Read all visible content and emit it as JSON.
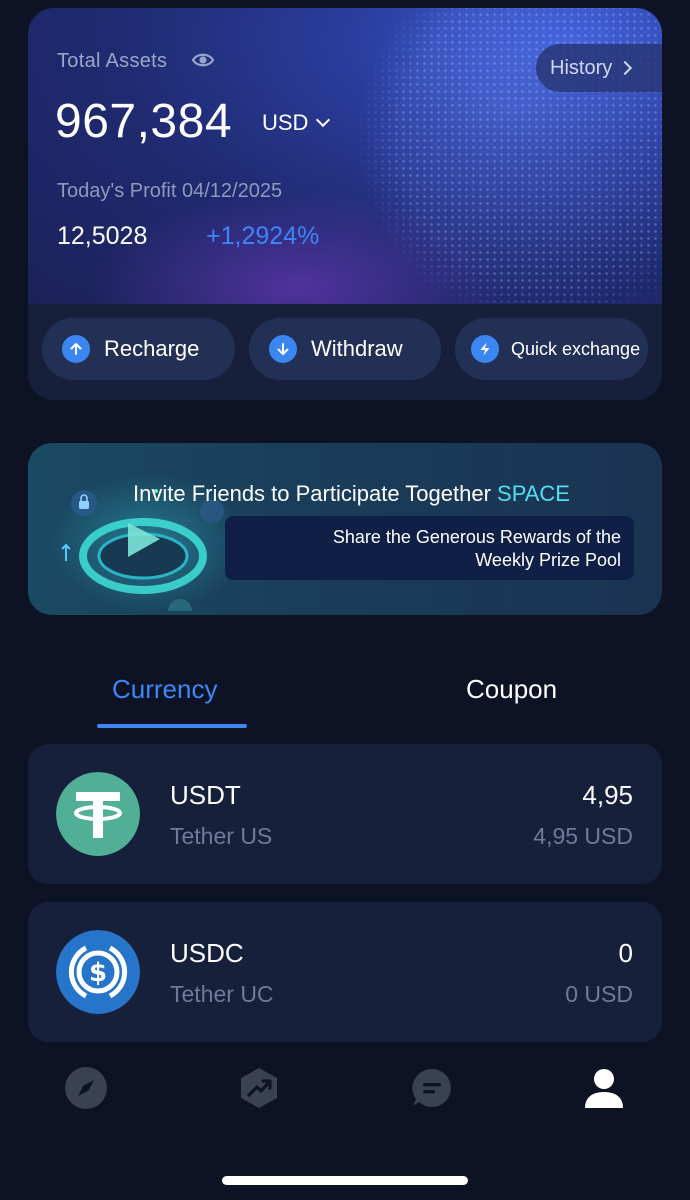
{
  "assets": {
    "total_label": "Total Assets",
    "total_value": "967,384",
    "currency": "USD",
    "history_label": "History",
    "profit_label": "Today's Profit 04/12/2025",
    "profit_amount": "12,5028",
    "profit_percent": "+1,2924%"
  },
  "actions": {
    "recharge": "Recharge",
    "withdraw": "Withdraw",
    "quick_exchange": "Quick exchange"
  },
  "banner": {
    "title": "Invite Friends to Participate Together",
    "title_accent": "SPACE",
    "subtitle_line1": "Share the Generous Rewards of the",
    "subtitle_line2": "Weekly Prize Pool"
  },
  "tabs": {
    "currency": "Currency",
    "coupon": "Coupon",
    "active": "Currency"
  },
  "coins": [
    {
      "symbol": "USDT",
      "name": "Tether US",
      "amount": "4,95",
      "value": "4,95 USD"
    },
    {
      "symbol": "USDC",
      "name": "Tether UC",
      "amount": "0",
      "value": "0 USD"
    }
  ],
  "nav": {
    "items": [
      "compass-icon",
      "trend-icon",
      "chat-icon",
      "profile-icon"
    ],
    "active": "profile-icon"
  },
  "colors": {
    "accent": "#3d86f5",
    "background": "#0d1324",
    "card": "#17203a",
    "usdt": "#50af95",
    "usdc": "#2775ca"
  }
}
